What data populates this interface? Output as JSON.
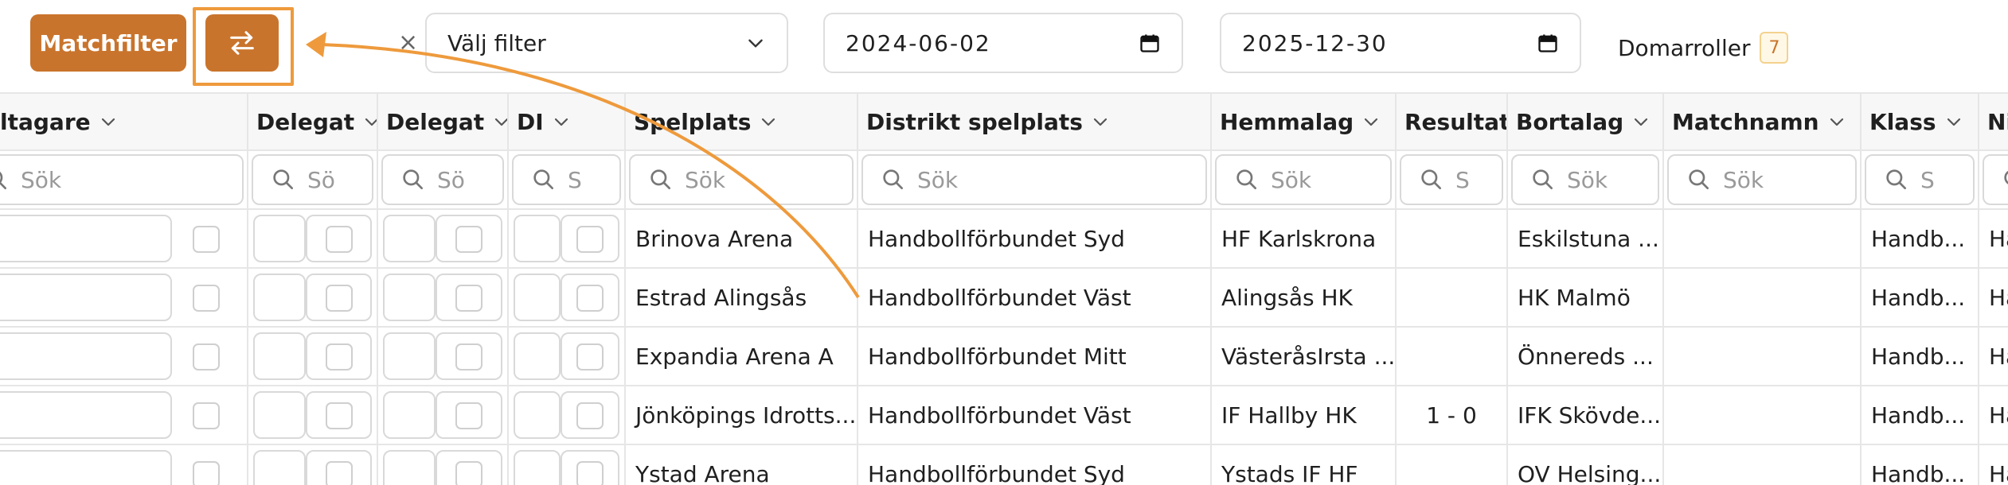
{
  "toolbar": {
    "matchfilter_label": "Matchfilter",
    "clear_symbol": "×",
    "filter_placeholder": "Välj filter",
    "date_from": "2024-06-02",
    "date_to": "2025-12-30",
    "domarroller_label": "Domarroller",
    "domarroller_count": "7",
    "accent_color": "#c9742c",
    "highlight_color": "#ee9a3c"
  },
  "columns": [
    {
      "label": "ltagare",
      "search": "Sök"
    },
    {
      "label": "Delegat",
      "search": "Sö"
    },
    {
      "label": "Delegat",
      "search": "Sö"
    },
    {
      "label": "DI",
      "search": "S"
    },
    {
      "label": "Spelplats",
      "search": "Sök"
    },
    {
      "label": "Distrikt spelplats",
      "search": "Sök"
    },
    {
      "label": "Hemmalag",
      "search": "Sök"
    },
    {
      "label": "Resultat",
      "search": "S"
    },
    {
      "label": "Bortalag",
      "search": "Sök"
    },
    {
      "label": "Matchnamn",
      "search": "Sök"
    },
    {
      "label": "Klass",
      "search": "S"
    },
    {
      "label": "Niv",
      "search": ""
    }
  ],
  "rows": [
    {
      "spelplats": "Brinova Arena",
      "distrikt": "Handbollförbundet Syd",
      "hemmalag": "HF Karlskrona",
      "resultat": "",
      "bortalag": "Eskilstuna ...",
      "matchnamn": "",
      "klass": "Handb...",
      "niva": "Ha"
    },
    {
      "spelplats": "Estrad Alingsås",
      "distrikt": "Handbollförbundet Väst",
      "hemmalag": "Alingsås HK",
      "resultat": "",
      "bortalag": "HK Malmö",
      "matchnamn": "",
      "klass": "Handb...",
      "niva": "Ha"
    },
    {
      "spelplats": "Expandia Arena A",
      "distrikt": "Handbollförbundet Mitt",
      "hemmalag": "VästeråsIrsta ...",
      "resultat": "",
      "bortalag": "Önnereds ...",
      "matchnamn": "",
      "klass": "Handb...",
      "niva": "Ha"
    },
    {
      "spelplats": "Jönköpings Idrotts...",
      "distrikt": "Handbollförbundet Väst",
      "hemmalag": "IF Hallby HK",
      "resultat": "1 - 0",
      "bortalag": "IFK Skövde...",
      "matchnamn": "",
      "klass": "Handb...",
      "niva": "Ha"
    },
    {
      "spelplats": "Ystad Arena",
      "distrikt": "Handbollförbundet Syd",
      "hemmalag": "Ystads IF HF",
      "resultat": "",
      "bortalag": "OV Helsing...",
      "matchnamn": "",
      "klass": "Handb...",
      "niva": "Ha"
    }
  ]
}
